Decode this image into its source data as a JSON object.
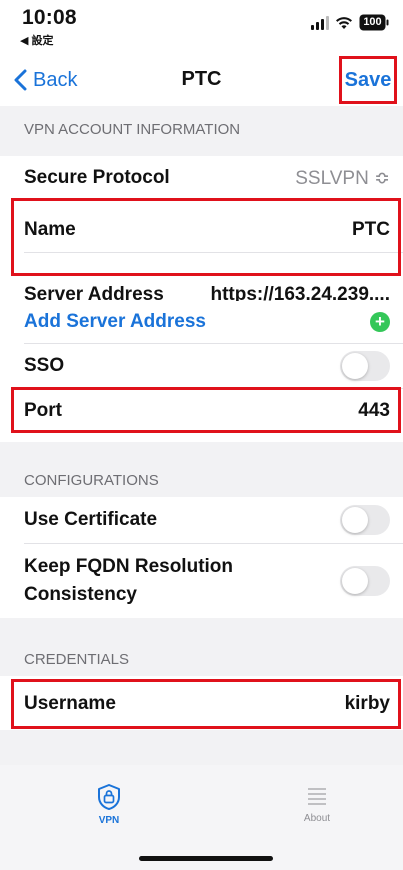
{
  "status_bar": {
    "time": "10:08",
    "back_app": "◀ 設定",
    "battery": "100"
  },
  "nav": {
    "back_label": "Back",
    "title": "PTC",
    "save_label": "Save"
  },
  "sections": {
    "vpn_account": "VPN ACCOUNT INFORMATION",
    "configurations": "CONFIGURATIONS",
    "credentials": "CREDENTIALS"
  },
  "vpn_account": {
    "secure_protocol_label": "Secure Protocol",
    "secure_protocol_value": "SSLVPN ≎",
    "name_label": "Name",
    "name_value": "PTC",
    "server_address_label": "Server Address",
    "server_address_value": "https://163.24.239....",
    "add_server_label": "Add Server Address",
    "sso_label": "SSO",
    "sso_on": false,
    "port_label": "Port",
    "port_value": "443"
  },
  "configurations": {
    "use_certificate_label": "Use Certificate",
    "use_certificate_on": false,
    "keep_fqdn_label_line1": "Keep FQDN Resolution",
    "keep_fqdn_label_line2": "Consistency",
    "keep_fqdn_on": false
  },
  "credentials": {
    "username_label": "Username",
    "username_value": "kirby"
  },
  "tab_bar": {
    "vpn_label": "VPN",
    "about_label": "About",
    "active_tab": "VPN"
  },
  "colors": {
    "accent": "#1a73d9",
    "highlight": "#e0111b",
    "add_green": "#34c759",
    "group_bg": "#f2f2f4"
  }
}
